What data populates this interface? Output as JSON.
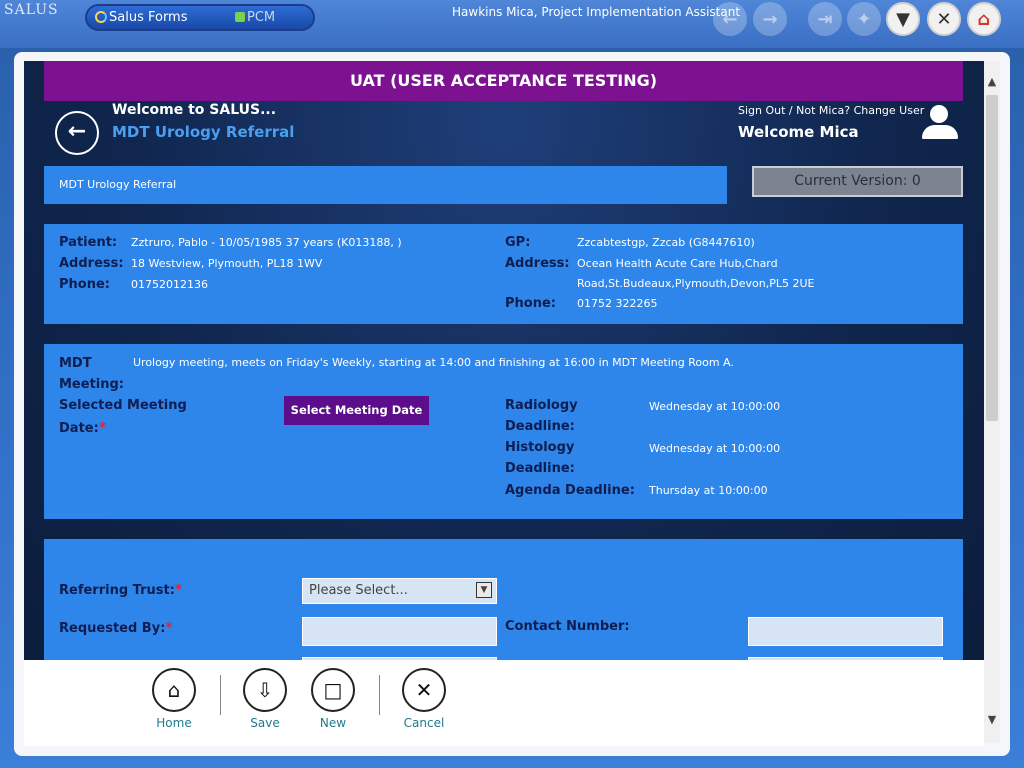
{
  "topbar": {
    "logo": "SALUS",
    "apps": [
      {
        "label": "Salus Forms"
      },
      {
        "label": "PCM"
      }
    ],
    "user_title": "Hawkins Mica, Project Implementation Assistant",
    "buttons": [
      {
        "icon": "arrow-left-icon"
      },
      {
        "icon": "arrow-right-icon"
      },
      {
        "icon": "exit-icon"
      },
      {
        "icon": "tools-icon"
      },
      {
        "icon": "filter-icon"
      },
      {
        "icon": "close-icon"
      },
      {
        "icon": "home-icon"
      }
    ]
  },
  "banner": "UAT (USER ACCEPTANCE TESTING)",
  "header": {
    "welcome_salus": "Welcome to SALUS...",
    "form_title": "MDT Urology Referral",
    "signout": "Sign Out / Not Mica? Change User",
    "welcome_user": "Welcome Mica"
  },
  "breadcrumb": "MDT Urology Referral",
  "version": "Current Version: 0",
  "patient": {
    "patient_label": "Patient:",
    "patient_value": "Zztruro, Pablo - 10/05/1985 37 years (K013188, )",
    "address_label": "Address:",
    "address_value": "18 Westview, Plymouth, PL18 1WV",
    "phone_label": "Phone:",
    "phone_value": "01752012136",
    "gp_label": "GP:",
    "gp_value": "Zzcabtestgp, Zzcab (G8447610)",
    "gp_address_label": "Address:",
    "gp_address_line1": "Ocean Health Acute Care Hub,Chard",
    "gp_address_line2": "Road,St.Budeaux,Plymouth,Devon,PL5 2UE",
    "gp_phone_label": "Phone:",
    "gp_phone_value": "01752 322265"
  },
  "meeting": {
    "mdt_label_1": "MDT",
    "mdt_label_2": "Meeting:",
    "mdt_value": "Urology meeting, meets on Friday's Weekly, starting at 14:00 and finishing at 16:00 in MDT Meeting Room A.",
    "selected_label_1": "Selected Meeting",
    "selected_label_2": "Date:",
    "select_button": "Select Meeting Date",
    "radiology_label_1": "Radiology",
    "radiology_label_2": "Deadline:",
    "radiology_value": "Wednesday at 10:00:00",
    "histology_label_1": "Histology",
    "histology_label_2": "Deadline:",
    "histology_value": "Wednesday at 10:00:00",
    "agenda_label": "Agenda Deadline:",
    "agenda_value": "Thursday at 10:00:00"
  },
  "referral": {
    "trust_label": "Referring Trust:",
    "trust_select": "Please Select...",
    "requested_label": "Requested By:",
    "requested_value": "",
    "contact_label": "Contact Number:",
    "contact_value": ""
  },
  "footer": {
    "home": "Home",
    "save": "Save",
    "new": "New",
    "cancel": "Cancel"
  }
}
